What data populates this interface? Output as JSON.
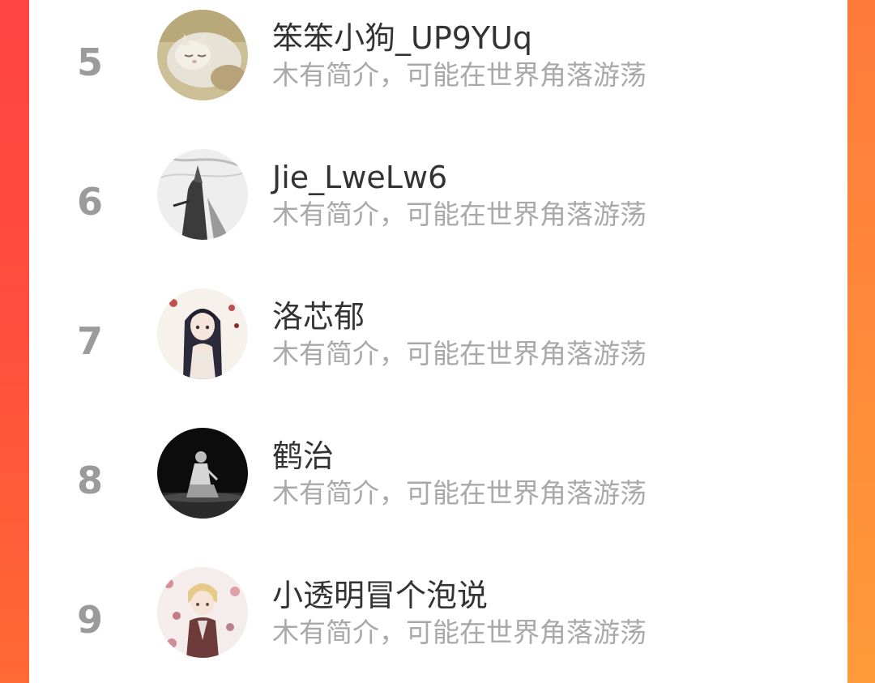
{
  "colors": {
    "background_start": "#ff4a3a",
    "background_end": "#ff7b35",
    "card": "#ffffff",
    "rank": "#9b9b9b",
    "name": "#333333",
    "bio": "#a9a9a9"
  },
  "ranking": {
    "items": [
      {
        "rank": "5",
        "name": "笨笨小狗_UP9YUq",
        "bio": "木有简介，可能在世界角落游荡",
        "avatar_icon": "sleeping-cat-avatar"
      },
      {
        "rank": "6",
        "name": "Jie_LweLw6",
        "bio": "木有简介，可能在世界角落游荡",
        "avatar_icon": "monochrome-figure-avatar"
      },
      {
        "rank": "7",
        "name": "洛芯郁",
        "bio": "木有简介，可能在世界角落游荡",
        "avatar_icon": "anime-girl-avatar"
      },
      {
        "rank": "8",
        "name": "鹤治",
        "bio": "木有简介，可能在世界角落游荡",
        "avatar_icon": "dark-seated-figure-avatar"
      },
      {
        "rank": "9",
        "name": "小透明冒个泡说",
        "bio": "木有简介，可能在世界角落游荡",
        "avatar_icon": "anime-boy-blossoms-avatar"
      }
    ]
  }
}
